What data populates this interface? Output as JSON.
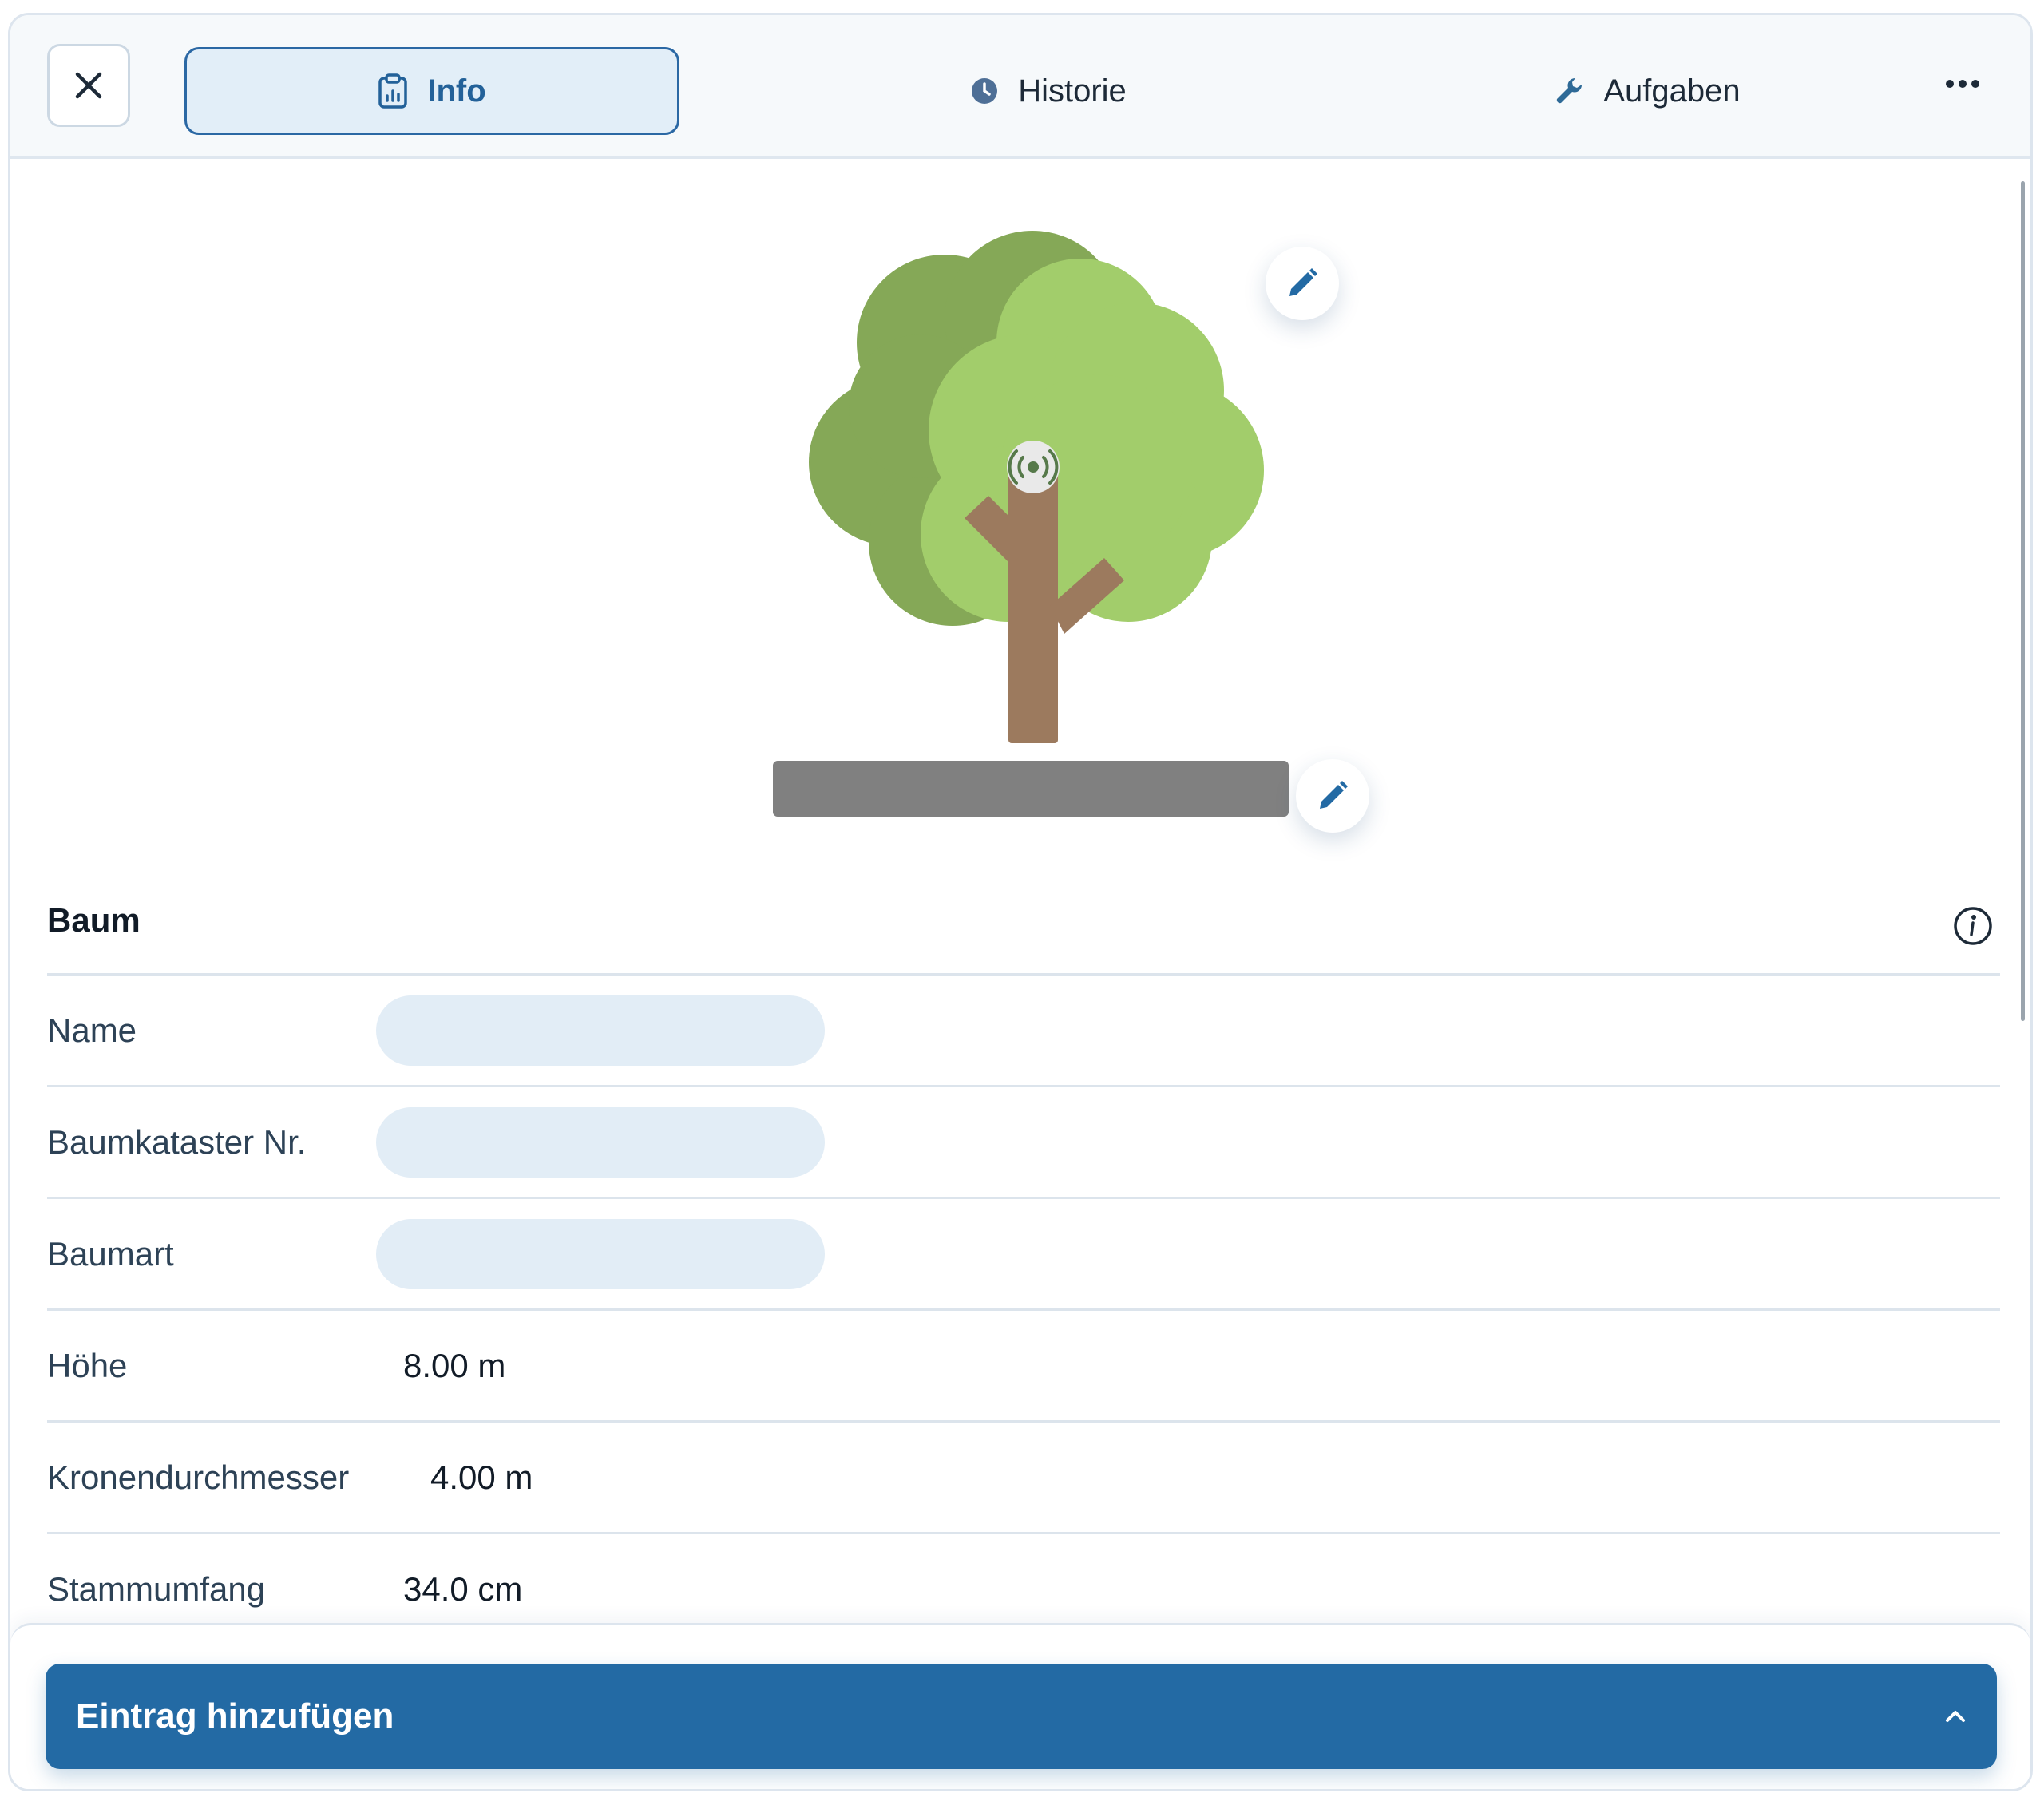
{
  "header": {
    "tabs": [
      {
        "label": "Info",
        "icon": "clipboard-chart-icon",
        "active": true
      },
      {
        "label": "Historie",
        "icon": "clock-icon",
        "active": false
      },
      {
        "label": "Aufgaben",
        "icon": "wrench-icon",
        "active": false
      }
    ],
    "more_icon": "more-horizontal-icon",
    "close_icon": "close-icon"
  },
  "illustration": {
    "subject": "tree-icon",
    "sensor_icon": "broadcast-sensor-icon"
  },
  "section": {
    "title": "Baum",
    "info_icon": "info-icon"
  },
  "fields": [
    {
      "label": "Name",
      "value": ""
    },
    {
      "label": "Baumkataster Nr.",
      "value": ""
    },
    {
      "label": "Baumart",
      "value": ""
    },
    {
      "label": "Höhe",
      "value": "8.00 m"
    },
    {
      "label": "Kronendurchmesser",
      "value": "4.00 m"
    },
    {
      "label": "Stammumfang",
      "value": "34.0 cm"
    }
  ],
  "footer": {
    "button_label": "Eintrag hinzufügen",
    "chevron_icon": "chevron-up-icon"
  },
  "colors": {
    "primary": "#236aa4",
    "tab_active_bg": "#e2eef8",
    "placeholder_pill": "#e2edf6",
    "tree_canopy_light": "#a2cd6b",
    "tree_canopy_dark": "#85a857",
    "tree_trunk": "#9c7a5e",
    "ground": "#808080"
  }
}
